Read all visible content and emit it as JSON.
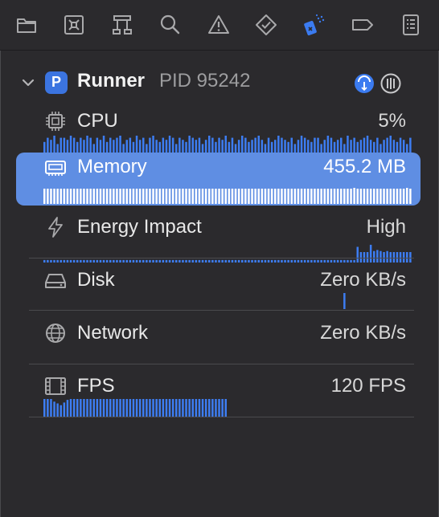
{
  "toolbar": {
    "icons": [
      {
        "name": "folder-icon"
      },
      {
        "name": "source-control-icon"
      },
      {
        "name": "hierarchy-icon"
      },
      {
        "name": "search-icon"
      },
      {
        "name": "warning-icon"
      },
      {
        "name": "test-diamond-icon"
      },
      {
        "name": "debug-spray-icon"
      },
      {
        "name": "breakpoint-icon"
      },
      {
        "name": "report-icon"
      }
    ],
    "active_color": "#3b7bf0"
  },
  "process": {
    "name": "Runner",
    "pid_label": "PID 95242",
    "icon_letter": "P"
  },
  "gauges": [
    {
      "key": "cpu",
      "label": "CPU",
      "value": "5%",
      "icon": "cpu-chip-icon"
    },
    {
      "key": "memory",
      "label": "Memory",
      "value": "455.2 MB",
      "icon": "memory-icon",
      "selected": true
    },
    {
      "key": "energy",
      "label": "Energy Impact",
      "value": "High",
      "icon": "lightning-bolt-icon"
    },
    {
      "key": "disk",
      "label": "Disk",
      "value": "Zero KB/s",
      "icon": "disk-drive-icon"
    },
    {
      "key": "network",
      "label": "Network",
      "value": "Zero KB/s",
      "icon": "globe-icon"
    },
    {
      "key": "fps",
      "label": "FPS",
      "value": "120 FPS",
      "icon": "film-strip-icon"
    }
  ],
  "sparklines": {
    "cpu": [
      0.7,
      0.9,
      0.8,
      1.0,
      0.6,
      0.9,
      0.9,
      0.8,
      1.0,
      0.9,
      0.7,
      0.9,
      0.8,
      1.0,
      0.9,
      0.6,
      0.9,
      0.8,
      1.0,
      0.7,
      0.9,
      0.8,
      0.9,
      1.0,
      0.6,
      0.8,
      0.9,
      0.7,
      1.0,
      0.8,
      0.9,
      0.6,
      0.9,
      1.0,
      0.8,
      0.7,
      0.9,
      0.8,
      1.0,
      0.9,
      0.6,
      0.9,
      0.8,
      0.7,
      1.0,
      0.9,
      0.8,
      0.9,
      0.6,
      0.8,
      1.0,
      0.9,
      0.7,
      0.9,
      0.8,
      1.0,
      0.7,
      0.9,
      0.6,
      0.8,
      1.0,
      0.9,
      0.7,
      0.8,
      0.9,
      1.0,
      0.8,
      0.6,
      0.9,
      0.7,
      0.8,
      1.0,
      0.9,
      0.8,
      0.7,
      0.9,
      0.6,
      0.8,
      1.0,
      0.9,
      0.8,
      0.7,
      0.9,
      0.9,
      0.6,
      0.8,
      1.0,
      0.9,
      0.7,
      0.8,
      0.9,
      0.6,
      1.0,
      0.8,
      0.9,
      0.7,
      0.8,
      0.9,
      1.0,
      0.8,
      0.7,
      0.9,
      0.6,
      0.8,
      0.9,
      1.0,
      0.8,
      0.7,
      0.9,
      0.8,
      0.6,
      0.9,
      1.0,
      0.8
    ],
    "memory": [
      0.95,
      0.95,
      0.95,
      0.95,
      0.95,
      0.95,
      0.95,
      0.95,
      0.95,
      0.95,
      0.95,
      0.95,
      0.95,
      0.95,
      0.95,
      0.95,
      0.95,
      0.95,
      0.95,
      0.95,
      0.95,
      0.95,
      0.95,
      0.95,
      0.95,
      0.95,
      0.95,
      0.95,
      0.95,
      0.95,
      0.95,
      0.95,
      0.95,
      0.95,
      0.95,
      0.95,
      0.95,
      0.95,
      0.95,
      0.95,
      0.95,
      0.95,
      0.95,
      0.95,
      0.95,
      0.95,
      0.95,
      0.95,
      0.95,
      0.95,
      0.95,
      0.95,
      0.95,
      0.95,
      0.95,
      0.95,
      0.95,
      0.95,
      0.95,
      0.95,
      0.95,
      0.95,
      0.95,
      0.95,
      0.95,
      0.95,
      0.95,
      0.95,
      0.95,
      0.95,
      0.95,
      0.95,
      0.95,
      0.95,
      0.95,
      0.95,
      0.95,
      0.95,
      0.95,
      0.95,
      0.95,
      0.95,
      0.95,
      0.95,
      0.95,
      0.95,
      0.95,
      0.95,
      0.95,
      0.95,
      0.95,
      0.95,
      0.95,
      0.95,
      1.0,
      0.95,
      0.95,
      0.95,
      0.95,
      0.95,
      0.95,
      0.95,
      0.95,
      0.95,
      0.95,
      0.95,
      0.95,
      0.95,
      0.95,
      0.95,
      1.0,
      0.95,
      0.95,
      0.95
    ],
    "energy": [
      0.12,
      0.12,
      0.12,
      0.12,
      0.12,
      0.12,
      0.12,
      0.12,
      0.12,
      0.12,
      0.12,
      0.12,
      0.12,
      0.12,
      0.12,
      0.12,
      0.12,
      0.12,
      0.12,
      0.12,
      0.12,
      0.12,
      0.12,
      0.12,
      0.12,
      0.12,
      0.12,
      0.12,
      0.12,
      0.12,
      0.12,
      0.12,
      0.12,
      0.12,
      0.12,
      0.12,
      0.12,
      0.12,
      0.12,
      0.12,
      0.12,
      0.12,
      0.12,
      0.12,
      0.12,
      0.12,
      0.12,
      0.12,
      0.12,
      0.12,
      0.12,
      0.12,
      0.12,
      0.12,
      0.12,
      0.12,
      0.12,
      0.12,
      0.12,
      0.12,
      0.12,
      0.12,
      0.12,
      0.12,
      0.12,
      0.12,
      0.12,
      0.12,
      0.12,
      0.12,
      0.12,
      0.12,
      0.12,
      0.12,
      0.12,
      0.12,
      0.12,
      0.12,
      0.12,
      0.12,
      0.12,
      0.12,
      0.12,
      0.12,
      0.12,
      0.12,
      0.12,
      0.12,
      0.12,
      0.12,
      0.12,
      0.12,
      0.12,
      0.12,
      0.12,
      0.75,
      0.5,
      0.5,
      0.5,
      0.85,
      0.55,
      0.6,
      0.55,
      0.5,
      0.55,
      0.5,
      0.5,
      0.5,
      0.5,
      0.5,
      0.5,
      0.5,
      0.5,
      0.5
    ],
    "disk": [
      0,
      0,
      0,
      0,
      0,
      0,
      0,
      0,
      0,
      0,
      0,
      0,
      0,
      0,
      0,
      0,
      0,
      0,
      0,
      0,
      0,
      0,
      0,
      0,
      0,
      0,
      0,
      0,
      0,
      0,
      0,
      0,
      0,
      0,
      0,
      0,
      0,
      0,
      0,
      0,
      0,
      0,
      0,
      0,
      0,
      0,
      0,
      0,
      0,
      0,
      0,
      0,
      0,
      0,
      0,
      0,
      0,
      0,
      0,
      0,
      0,
      0,
      0,
      0,
      0,
      0,
      0,
      0,
      0,
      0,
      0,
      0,
      0,
      0,
      0,
      0,
      0,
      0,
      0,
      0,
      0,
      0,
      0,
      0,
      0,
      0,
      0,
      0,
      0,
      0,
      0,
      1.0,
      0,
      0,
      0,
      0,
      0,
      0,
      0,
      0,
      0,
      0,
      0,
      0,
      0,
      0,
      0,
      0,
      0,
      0,
      0,
      0,
      0,
      0
    ],
    "network": [],
    "fps": [
      1.0,
      1.0,
      1.0,
      0.85,
      0.75,
      0.65,
      0.8,
      0.95,
      1.0,
      1.0,
      1.0,
      1.0,
      1.0,
      1.0,
      1.0,
      1.0,
      1.0,
      1.0,
      1.0,
      1.0,
      1.0,
      1.0,
      1.0,
      1.0,
      1.0,
      1.0,
      1.0,
      1.0,
      1.0,
      1.0,
      1.0,
      1.0,
      1.0,
      1.0,
      1.0,
      1.0,
      1.0,
      1.0,
      1.0,
      1.0,
      1.0,
      1.0,
      1.0,
      1.0,
      1.0,
      1.0,
      1.0,
      1.0,
      1.0,
      1.0,
      1.0,
      1.0,
      1.0,
      1.0,
      1.0,
      1.0
    ],
    "bar_color": "#3d7df2",
    "selected_bar_color": "#ffffff"
  }
}
